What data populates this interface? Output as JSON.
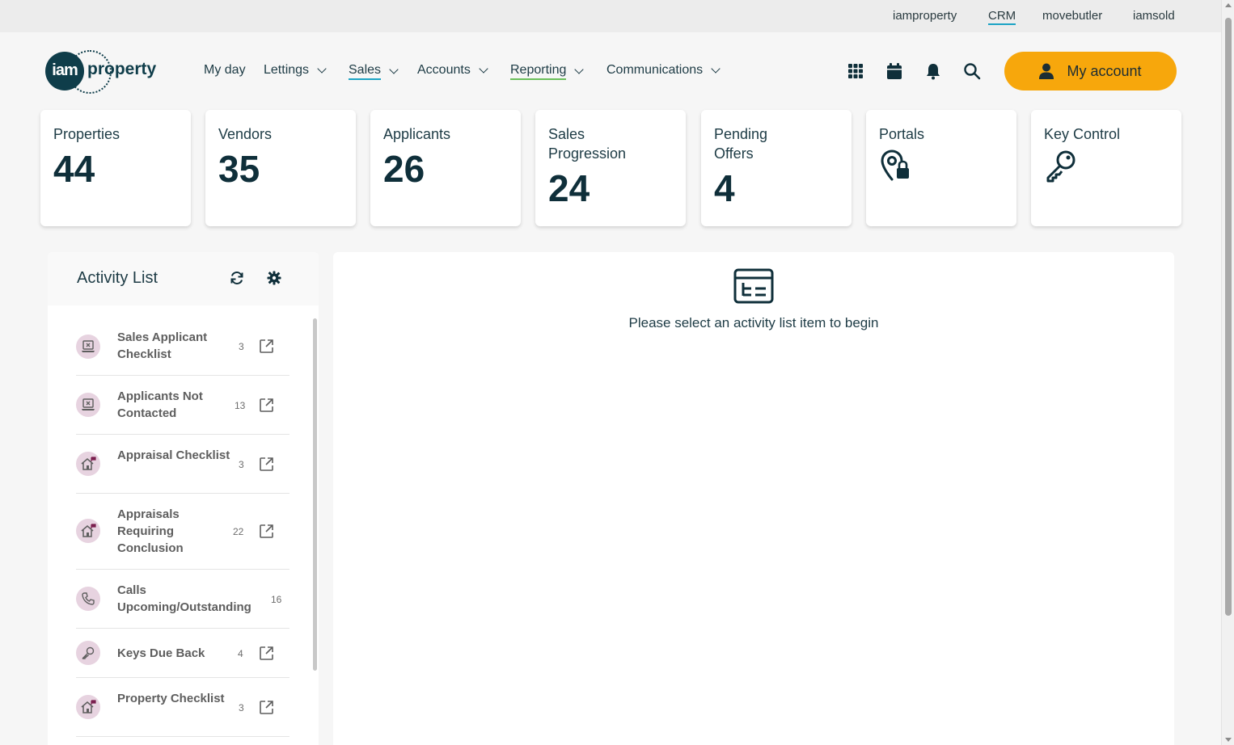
{
  "brands": [
    "iamproperty",
    "CRM",
    "movebutler",
    "iamsold"
  ],
  "logo": {
    "bubble": "iam",
    "word": "property"
  },
  "nav": {
    "my_day": "My day",
    "lettings": "Lettings",
    "sales": "Sales",
    "accounts": "Accounts",
    "reporting": "Reporting",
    "communications": "Communications"
  },
  "account": {
    "label": "My account"
  },
  "cards": {
    "properties": {
      "title": "Properties",
      "count": "44"
    },
    "vendors": {
      "title": "Vendors",
      "count": "35"
    },
    "applicants": {
      "title": "Applicants",
      "count": "26"
    },
    "sales_progression": {
      "title": "Sales Progression",
      "count": "24"
    },
    "pending_offers": {
      "title": "Pending Offers",
      "count": "4"
    },
    "portals": {
      "title": "Portals"
    },
    "key_control": {
      "title": "Key Control"
    }
  },
  "activity": {
    "title": "Activity List",
    "items": [
      {
        "label": "Sales Applicant Checklist",
        "count": "3",
        "icon": "laptop-x-icon"
      },
      {
        "label": "Applicants Not Contacted",
        "count": "13",
        "icon": "laptop-x-icon"
      },
      {
        "label": "Appraisal Checklist",
        "count": "3",
        "icon": "house-flag-icon"
      },
      {
        "label": "Appraisals Requiring Conclusion",
        "count": "22",
        "icon": "house-flag-icon"
      },
      {
        "label": "Calls Upcoming/Outstanding",
        "count": "16",
        "icon": "phone-icon"
      },
      {
        "label": "Keys Due Back",
        "count": "4",
        "icon": "key-icon"
      },
      {
        "label": "Property Checklist",
        "count": "3",
        "icon": "house-flag-icon"
      }
    ]
  },
  "main": {
    "empty_message": "Please select an activity list item to begin"
  },
  "colors": {
    "accent": "#f7a70c",
    "brand_dark": "#0f3d4a",
    "crm_underline": "#1ba3c4",
    "reporting_underline": "#6abf5a",
    "icon_circle": "#e7d3e0"
  }
}
